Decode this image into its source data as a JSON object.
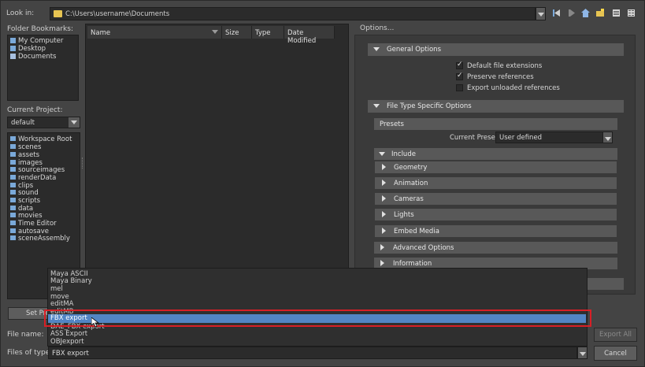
{
  "look_in": {
    "label": "Look in:",
    "path": "C:\\Users\\username\\Documents"
  },
  "left": {
    "bookmarks_label": "Folder Bookmarks:",
    "bookmarks": [
      "My Computer",
      "Desktop",
      "Documents"
    ],
    "project_label": "Current Project:",
    "project_value": "default",
    "tree": [
      "Workspace Root",
      "scenes",
      "assets",
      "images",
      "sourceimages",
      "renderData",
      "clips",
      "sound",
      "scripts",
      "data",
      "movies",
      "Time Editor",
      "autosave",
      "sceneAssembly"
    ],
    "set_project_label": "Set Pro"
  },
  "filelist": {
    "columns": [
      "Name",
      "Size",
      "Type",
      "Date Modified"
    ]
  },
  "options": {
    "title": "Options...",
    "general": {
      "title": "General Options",
      "checks": [
        {
          "label": "Default file extensions",
          "checked": true
        },
        {
          "label": "Preserve references",
          "checked": true
        },
        {
          "label": "Export unloaded references",
          "checked": false
        }
      ]
    },
    "filetype": {
      "title": "File Type Specific Options",
      "presets_title": "Presets",
      "current_preset_label": "Current Preset:",
      "current_preset_value": "User defined",
      "include_title": "Include",
      "include_items": [
        "Geometry",
        "Animation",
        "Cameras",
        "Lights",
        "Embed Media"
      ],
      "advanced_title": "Advanced Options",
      "information_title": "Information"
    }
  },
  "dropdown": {
    "items": [
      "Maya ASCII",
      "Maya Binary",
      "mel",
      "move",
      "editMA",
      "editMB",
      "FBX export",
      "DAE_FBX export",
      "ASS Export",
      "OBJexport"
    ],
    "selected": "FBX export"
  },
  "bottom": {
    "file_name_label": "File name:",
    "files_of_type_label": "Files of type:",
    "files_of_type_value": "FBX export",
    "export_all_label": "Export All",
    "cancel_label": "Cancel"
  },
  "colors": {
    "selection": "#5285c4",
    "highlight_box": "#d81f26",
    "folder_icon": "#e7c452"
  }
}
